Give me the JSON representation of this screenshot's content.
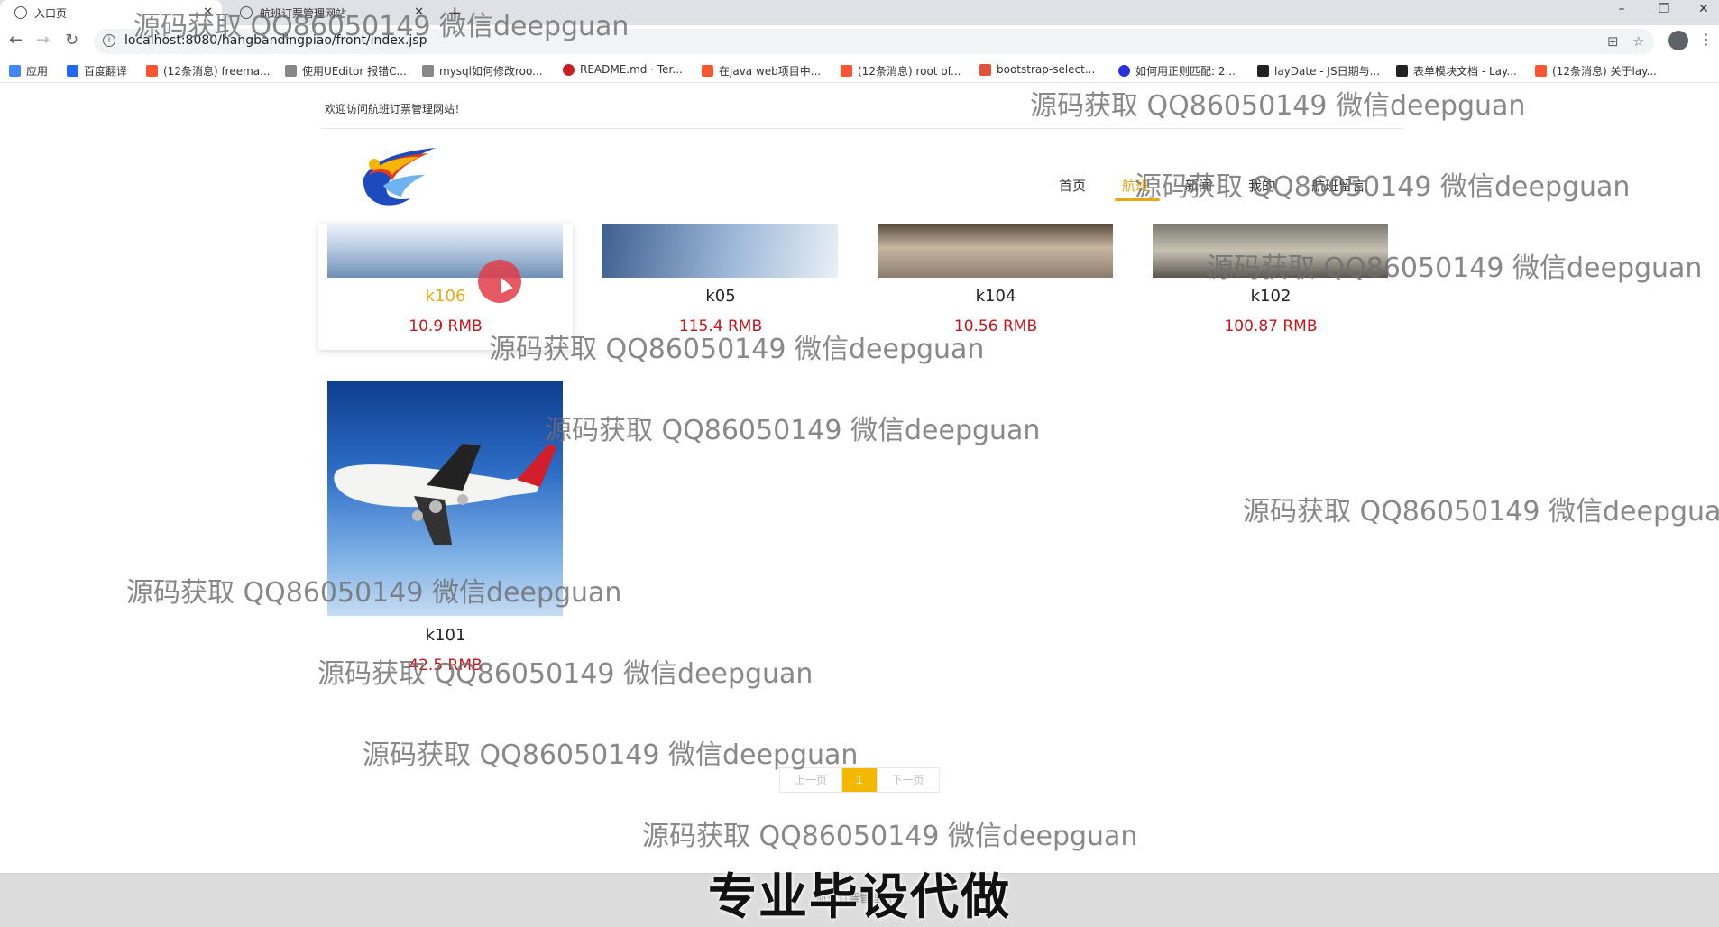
{
  "browser": {
    "tabs": [
      {
        "title": "入口页",
        "active": true
      },
      {
        "title": "航班订票管理网站",
        "active": false
      }
    ],
    "url": "localhost:8080/hangbandingpiao/front/index.jsp",
    "window_controls": {
      "minimize": "–",
      "restore": "❐",
      "close": "✕"
    },
    "bookmarks": [
      {
        "label": "应用",
        "icon": "apps-grid-icon",
        "color": "#4285f4"
      },
      {
        "label": "百度翻译",
        "icon": "baidu-translate-icon",
        "color": "#2468f2"
      },
      {
        "label": "(12条消息) freema...",
        "icon": "csdn-icon",
        "color": "#fc5531"
      },
      {
        "label": "使用UEditor 报错C...",
        "icon": "page-icon",
        "color": "#555555"
      },
      {
        "label": "mysql如何修改roo...",
        "icon": "page-icon",
        "color": "#555555"
      },
      {
        "label": "README.md · Ter...",
        "icon": "gitee-icon",
        "color": "#c71d23"
      },
      {
        "label": "在java web项目中...",
        "icon": "csdn-icon",
        "color": "#fc5531"
      },
      {
        "label": "(12条消息) root of...",
        "icon": "csdn-icon",
        "color": "#fc5531"
      },
      {
        "label": "bootstrap-select...",
        "icon": "page-icon",
        "color": "#e0523a"
      },
      {
        "label": "如何用正则匹配: 2...",
        "icon": "baidu-icon",
        "color": "#2932e1"
      },
      {
        "label": "layDate - JS日期与...",
        "icon": "layui-icon",
        "color": "#222222"
      },
      {
        "label": "表单模块文档 - Lay...",
        "icon": "layui-icon",
        "color": "#222222"
      },
      {
        "label": "(12条消息) 关于lay...",
        "icon": "csdn-icon",
        "color": "#fc5531"
      }
    ]
  },
  "site": {
    "welcome": "欢迎访问航班订票管理网站！",
    "logo_icon": "flame-logo-icon",
    "nav": [
      {
        "label": "首页",
        "active": false
      },
      {
        "label": "航班",
        "active": true
      },
      {
        "label": "新闻",
        "active": false
      },
      {
        "label": "我的",
        "active": false
      },
      {
        "label": "航班留言",
        "active": false
      }
    ],
    "accent_color": "#e6a817",
    "price_color": "#c8151b"
  },
  "flights": [
    {
      "name": "k106",
      "price": "10.9 RMB",
      "image": "sky-photo",
      "hovered": true
    },
    {
      "name": "k05",
      "price": "115.4 RMB",
      "image": "sky-photo",
      "hovered": false
    },
    {
      "name": "k104",
      "price": "10.56 RMB",
      "image": "clouds-photo",
      "hovered": false
    },
    {
      "name": "k102",
      "price": "100.87 RMB",
      "image": "jet-photo",
      "hovered": false
    },
    {
      "name": "k101",
      "price": "42.5 RMB",
      "image": "airplane-photo",
      "hovered": false
    }
  ],
  "pagination": {
    "prev": "上一页",
    "current": "1",
    "next": "下一页"
  },
  "footer": {
    "text": "航班订票管理网站"
  },
  "overlay": {
    "watermark": "源码获取 QQ86050149 微信deepguan",
    "banner": "专业毕设代做"
  }
}
